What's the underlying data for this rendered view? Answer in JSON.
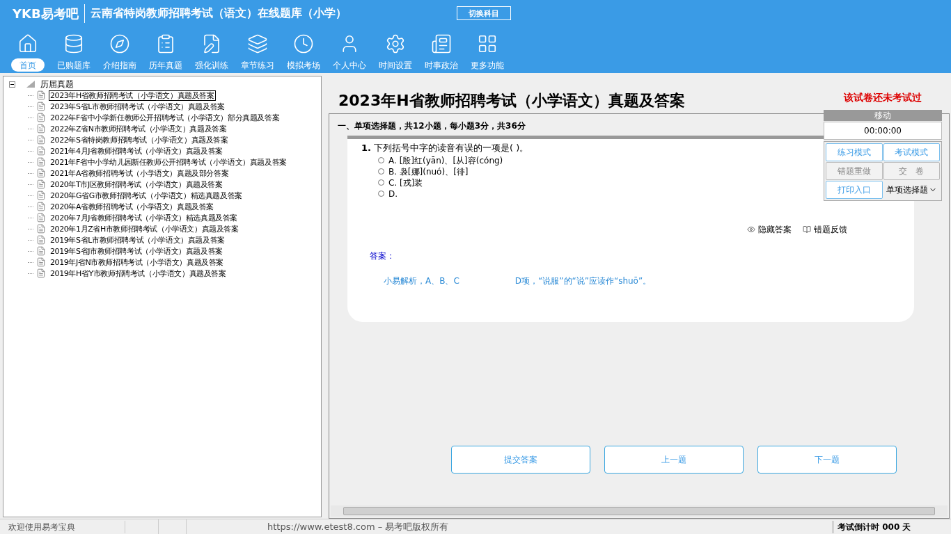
{
  "app": {
    "logo": "YKB易考吧",
    "title": "云南省特岗教师招聘考试（语文）在线题库（小学）",
    "switch_button": "切换科目"
  },
  "nav": [
    {
      "label": "首页",
      "selected": true
    },
    {
      "label": "已购题库",
      "selected": false
    },
    {
      "label": "介绍指南",
      "selected": false
    },
    {
      "label": "历年真题",
      "selected": false
    },
    {
      "label": "强化训练",
      "selected": false
    },
    {
      "label": "章节练习",
      "selected": false
    },
    {
      "label": "模拟考场",
      "selected": false
    },
    {
      "label": "个人中心",
      "selected": false
    },
    {
      "label": "时间设置",
      "selected": false
    },
    {
      "label": "时事政治",
      "selected": false
    },
    {
      "label": "更多功能",
      "selected": false
    }
  ],
  "tree": {
    "label": "历届真题",
    "expanded": true,
    "children": [
      {
        "label": "2023年H省教师招聘考试（小学语文）真题及答案",
        "selected": true
      },
      {
        "label": "2023年S省L市教师招聘考试（小学语文）真题及答案",
        "selected": false
      },
      {
        "label": "2022年F省中小学新任教师公开招聘考试（小学语文）部分真题及答案",
        "selected": false
      },
      {
        "label": "2022年Z省N市教师招聘考试（小学语文）真题及答案",
        "selected": false
      },
      {
        "label": "2022年S省特岗教师招聘考试（小学语文）真题及答案",
        "selected": false
      },
      {
        "label": "2021年4月J省教师招聘考试（小学语文）真题及答案",
        "selected": false
      },
      {
        "label": "2021年F省中小学幼儿园新任教师公开招聘考试（小学语文）真题及答案",
        "selected": false
      },
      {
        "label": "2021年A省教师招聘考试（小学语文）真题及部分答案",
        "selected": false
      },
      {
        "label": "2020年T市J区教师招聘考试（小学语文）真题及答案",
        "selected": false
      },
      {
        "label": "2020年G省G市教师招聘考试（小学语文）精选真题及答案",
        "selected": false
      },
      {
        "label": "2020年A省教师招聘考试（小学语文）真题及答案",
        "selected": false
      },
      {
        "label": "2020年7月J省教师招聘考试（小学语文）精选真题及答案",
        "selected": false
      },
      {
        "label": "2020年1月Z省H市教师招聘考试（小学语文）真题及答案",
        "selected": false
      },
      {
        "label": "2019年S省L市教师招聘考试（小学语文）真题及答案",
        "selected": false
      },
      {
        "label": "2019年S省J市教师招聘考试（小学语文）真题及答案",
        "selected": false
      },
      {
        "label": "2019年J省N市教师招聘考试（小学语文）真题及答案",
        "selected": false
      },
      {
        "label": "2019年H省Y市教师招聘考试（小学语文）真题及答案",
        "selected": false
      }
    ]
  },
  "paper": {
    "title": "2023年H省教师招聘考试（小学语文）真题及答案",
    "status": "该试卷还未考试过",
    "section": "一、单项选择题，共12小题，每小题3分，共36分",
    "question": {
      "number": "1.",
      "text": "下列括号中字的读音有误的一项是(  )。",
      "options": [
        {
          "label": "A. [殷]红(yān)、[从]容(cóng)",
          "selected": false
        },
        {
          "label": "B. 袅[娜](nuó)、[徘]",
          "selected": false
        },
        {
          "label": "C. [戎]装",
          "selected": false
        },
        {
          "label": "D.",
          "selected": false
        }
      ]
    },
    "hide_answer": "隐藏答案",
    "report_error": "错题反馈",
    "answer_label": "答案：",
    "analysis": "小易解析，A、B、C",
    "analysis_end": "D项，“说服”的“说”应读作“shuō”。"
  },
  "side_panel": {
    "header": "移动",
    "timer": "00:00:00",
    "buttons": [
      {
        "label": "练习模式",
        "disabled": false
      },
      {
        "label": "考试模式",
        "disabled": false
      },
      {
        "label": "错题重做",
        "disabled": true
      },
      {
        "label": "交　卷",
        "disabled": true
      },
      {
        "label": "打印入口",
        "disabled": false
      }
    ],
    "type_select": "单项选择题"
  },
  "actions": [
    "提交答案",
    "上一题",
    "下一题"
  ],
  "status_bar": {
    "welcome": "欢迎使用易考宝典",
    "copyright": "https://www.etest8.com – 易考吧版权所有",
    "countdown": "考试倒计时 000 天"
  }
}
